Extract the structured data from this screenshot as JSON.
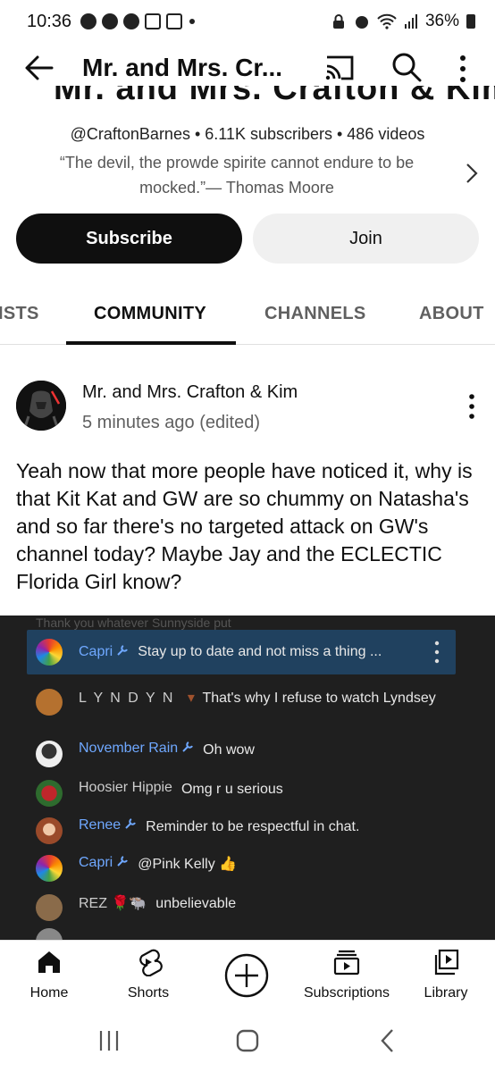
{
  "status_bar": {
    "time": "10:36",
    "battery": "36%"
  },
  "app_bar": {
    "title": "Mr. and Mrs. Cr..."
  },
  "channel": {
    "banner_name": "Mr. and Mrs. Crafton & Kim",
    "handle_line": "@CraftonBarnes • 6.11K subscribers • 486 videos",
    "bio": "“The devil, the prowde spirite cannot endure to be mocked.”— Thomas Moore"
  },
  "buttons": {
    "subscribe": "Subscribe",
    "join": "Join"
  },
  "tabs": [
    {
      "label": "ISTS"
    },
    {
      "label": "COMMUNITY"
    },
    {
      "label": "CHANNELS"
    },
    {
      "label": "ABOUT"
    }
  ],
  "post": {
    "author": "Mr. and Mrs. Crafton & Kim",
    "time": "5 minutes ago (edited)",
    "text": "Yeah now that more people have noticed it, why is that Kit Kat and GW are so chummy on Natasha's and so far there's no targeted attack on GW's channel today? Maybe Jay and the ECLECTIC Florida Girl know?"
  },
  "chat": {
    "top_faded": "Thank you  whatever  Sunnyside  put",
    "messages": [
      {
        "name": "Capri",
        "message": "Stay up to date and not miss a thing ...",
        "avatar_color": "#e04b3a"
      },
      {
        "name": "L Y N D Y N",
        "message": "That's why I refuse to watch Lyndsey",
        "avatar_color": "#b5712f"
      },
      {
        "name": "November Rain",
        "message": "Oh wow",
        "avatar_color": "#ddd"
      },
      {
        "name": "Hoosier Hippie",
        "message": "Omg r u serious",
        "avatar_color": "#c0262b"
      },
      {
        "name": "Renee",
        "message": "Reminder to be respectful in chat.",
        "avatar_color": "#c98a6a"
      },
      {
        "name": "Capri",
        "message": "@Pink Kelly 👍",
        "avatar_color": "#e04b3a"
      },
      {
        "name": "REZ 🌹🐃",
        "message": "unbelievable",
        "avatar_color": "#8a6b4a"
      }
    ]
  },
  "bottom_nav": {
    "home": "Home",
    "shorts": "Shorts",
    "subscriptions": "Subscriptions",
    "library": "Library"
  }
}
